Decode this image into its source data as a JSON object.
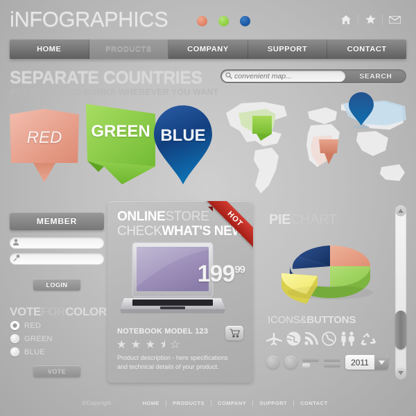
{
  "header": {
    "logo_i": "i",
    "logo_rest": "NFOGRAPHICS",
    "dots": [
      "#e08a6e",
      "#8fd14f",
      "#1c5ca8"
    ],
    "icons": [
      {
        "name": "home-icon",
        "label": "home"
      },
      {
        "name": "star-icon",
        "label": "star"
      },
      {
        "name": "envelope-icon",
        "label": "mail"
      }
    ]
  },
  "nav": {
    "items": [
      {
        "label": "HOME",
        "active": false
      },
      {
        "label": "PRODUCTS",
        "active": true
      },
      {
        "label": "COMPANY",
        "active": false
      },
      {
        "label": "SUPPORT",
        "active": false
      },
      {
        "label": "CONTACT",
        "active": false
      }
    ]
  },
  "countries": {
    "title": "SEPARATE COUNTRIES",
    "subtitle": "PUT FLAGS AND MARKS WHEREVER YOU WANT",
    "markers": [
      {
        "label": "RED",
        "color": "#e8a392",
        "shape": "pin-flag"
      },
      {
        "label": "GREEN",
        "color": "#8cce46",
        "shape": "ribbon-flag"
      },
      {
        "label": "BLUE",
        "color": "#15549d",
        "shape": "map-pin"
      }
    ]
  },
  "search": {
    "placeholder": "convenient map...",
    "value": "",
    "button_label": "SEARCH",
    "icon": "search-icon"
  },
  "map": {
    "markers": [
      {
        "region": "north-america",
        "color": "#8cce46",
        "type": "flag"
      },
      {
        "region": "africa",
        "color": "#dd9079",
        "type": "flag"
      },
      {
        "region": "russia",
        "color": "#1b4f96",
        "type": "pin"
      }
    ]
  },
  "member": {
    "title": "MEMBER",
    "username": {
      "placeholder": "",
      "value": "",
      "icon": "user-icon"
    },
    "password": {
      "placeholder": "",
      "value": "",
      "icon": "key-icon"
    },
    "login_label": "LOGIN"
  },
  "vote": {
    "title_bold1": "VOTE",
    "title_light": "FOR",
    "title_bold2": "COLOR",
    "options": [
      {
        "label": "RED",
        "selected": true
      },
      {
        "label": "GREEN",
        "selected": false
      },
      {
        "label": "BLUE",
        "selected": false
      }
    ],
    "button_label": "VOTE"
  },
  "store": {
    "title_bold": "ONLINE",
    "title_light": "STORE",
    "subtitle_light": "CHECK",
    "subtitle_bold": "WHAT'S NEW",
    "ribbon": "HOT",
    "price_main": "199",
    "price_cents": "99",
    "product_name": "NOTEBOOK MODEL 123",
    "rating": 3.5,
    "rating_max": 5,
    "description": "Product description - here specifications and technical details of your product.",
    "cart_icon": "shopping-cart-icon"
  },
  "pie": {
    "title_bold": "PIE",
    "title_light": "CHART"
  },
  "chart_data": {
    "type": "pie",
    "title": "PIECHART",
    "labels": [
      "Salmon",
      "Green",
      "Yellow",
      "Blue"
    ],
    "values": [
      22,
      38,
      20,
      20
    ],
    "colors": [
      "#e79a80",
      "#9ed45f",
      "#f5ef7a",
      "#1c3f7a"
    ],
    "exploded": [
      false,
      false,
      true,
      false
    ],
    "style": "3d",
    "legend": "none"
  },
  "icons_buttons": {
    "title_light": "ICONS",
    "title_amp": "&",
    "title_bold": "BUTTONS",
    "icons": [
      {
        "name": "airplane-icon"
      },
      {
        "name": "globe-icon"
      },
      {
        "name": "wifi-icon"
      },
      {
        "name": "phone-icon"
      },
      {
        "name": "people-icon"
      },
      {
        "name": "recycle-icon"
      }
    ],
    "year_select": {
      "value": "2011",
      "icon": "chevron-down-icon"
    }
  },
  "scrollbar": {
    "up_icon": "triangle-up-icon",
    "down_icon": "triangle-down-icon",
    "position_percent": 65
  },
  "footer": {
    "copyright": "©Copyright",
    "links": [
      "HOME",
      "PRODUCTS",
      "COMPANY",
      "SUPPORT",
      "CONTACT"
    ]
  }
}
